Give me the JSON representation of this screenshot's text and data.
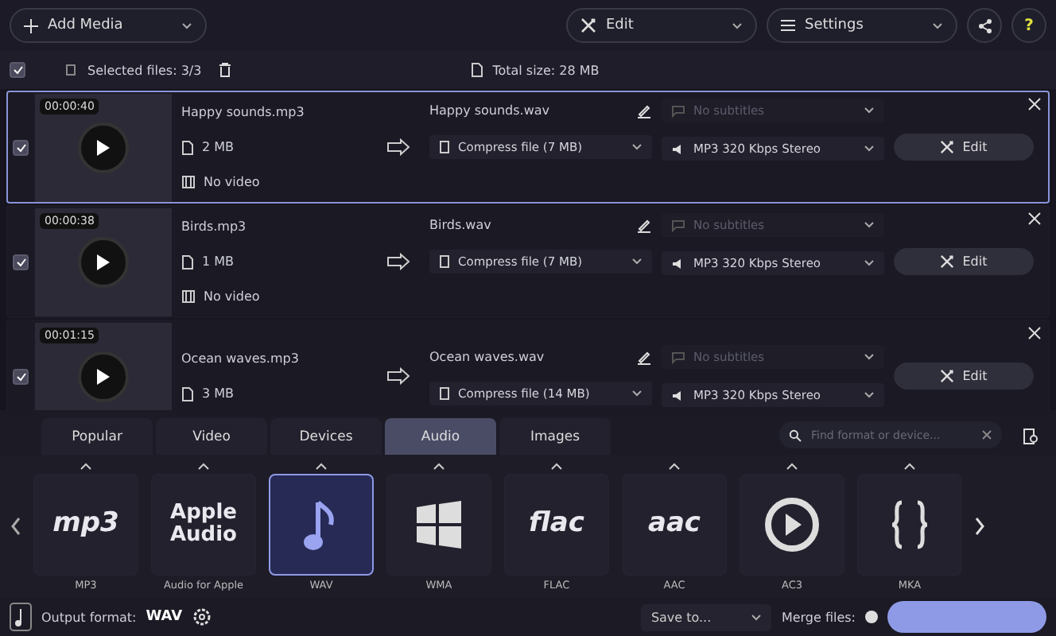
{
  "toolbar": {
    "add_media": "Add Media",
    "edit": "Edit",
    "settings": "Settings",
    "help": "?"
  },
  "selection": {
    "checked": true,
    "selected_files": "Selected files: 3/3",
    "total_size": "Total size: 28 MB"
  },
  "files": [
    {
      "checked": true,
      "selected": true,
      "duration": "00:00:40",
      "source": "Happy sounds.mp3",
      "size": "2 MB",
      "video": "No video",
      "output": "Happy sounds.wav",
      "compress": "Compress file (7 MB)",
      "subtitles": "No subtitles",
      "audio": "MP3 320 Kbps Stereo",
      "edit": "Edit"
    },
    {
      "checked": true,
      "selected": false,
      "duration": "00:00:38",
      "source": "Birds.mp3",
      "size": "1 MB",
      "video": "No video",
      "output": "Birds.wav",
      "compress": "Compress file (7 MB)",
      "subtitles": "No subtitles",
      "audio": "MP3 320 Kbps Stereo",
      "edit": "Edit"
    },
    {
      "checked": true,
      "selected": false,
      "duration": "00:01:15",
      "source": "Ocean waves.mp3",
      "size": "3 MB",
      "output": "Ocean waves.wav",
      "compress": "Compress file (14 MB)",
      "subtitles": "No subtitles",
      "audio": "MP3 320 Kbps Stereo",
      "edit": "Edit"
    }
  ],
  "tabs": [
    {
      "label": "Popular",
      "selected": false
    },
    {
      "label": "Video",
      "selected": false
    },
    {
      "label": "Devices",
      "selected": false
    },
    {
      "label": "Audio",
      "selected": true
    },
    {
      "label": "Images",
      "selected": false
    }
  ],
  "search": {
    "placeholder": "Find format or device..."
  },
  "formats": [
    {
      "kind": "text",
      "logo": [
        "mp3"
      ],
      "label": "MP3",
      "selected": false
    },
    {
      "kind": "text",
      "logo": [
        "Apple",
        "Audio"
      ],
      "label": "Audio for Apple",
      "selected": false
    },
    {
      "kind": "note",
      "label": "WAV",
      "selected": true
    },
    {
      "kind": "windows",
      "label": "WMA",
      "selected": false
    },
    {
      "kind": "text",
      "logo": [
        "flac"
      ],
      "label": "FLAC",
      "selected": false
    },
    {
      "kind": "text",
      "logo": [
        "aac"
      ],
      "label": "AAC",
      "selected": false
    },
    {
      "kind": "play",
      "label": "AC3",
      "selected": false
    },
    {
      "kind": "braces",
      "label": "MKA",
      "selected": false
    }
  ],
  "bottom": {
    "output_label": "Output format:",
    "output_value": "WAV",
    "save_to": "Save to...",
    "merge_label": "Merge files:",
    "merge_on": false
  }
}
